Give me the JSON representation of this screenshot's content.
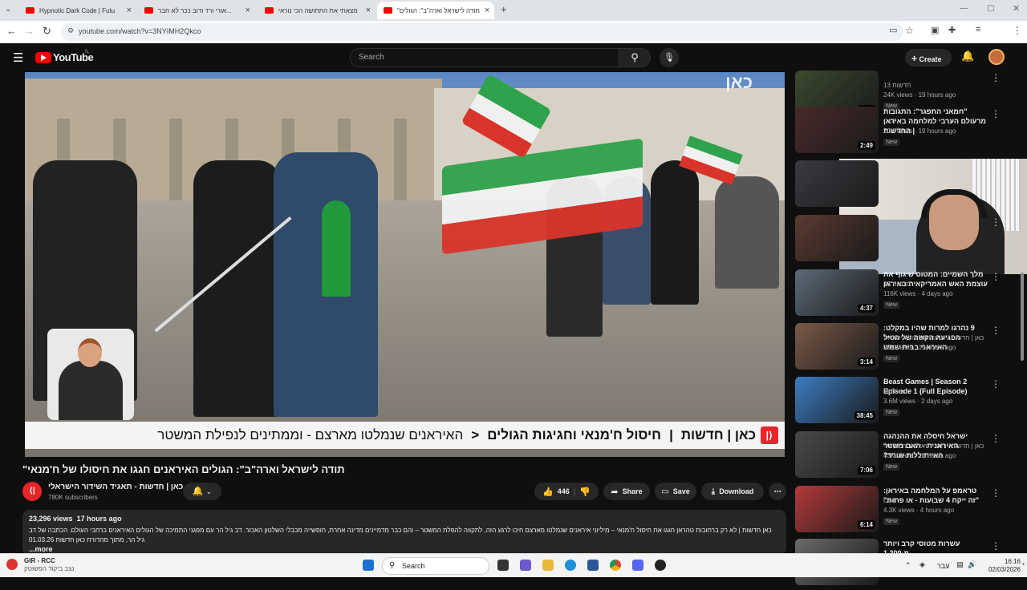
{
  "browser": {
    "tabs": [
      {
        "label": "Hypnotic Dark Code | Futu",
        "active": false
      },
      {
        "label": "אורי ורד ודוב ככר לא חבר...",
        "active": false
      },
      {
        "label": "מצאתי את התחושה הכי נוראי",
        "active": false
      },
      {
        "label": "\"תודה לישראל וארה\"ב\": הגולים",
        "active": true
      }
    ],
    "new_tab": "+",
    "url": "youtube.com/watch?v=3NYIMH2Qkco"
  },
  "youtube": {
    "logo": "YouTube",
    "region": "IL",
    "search_placeholder": "Search",
    "create_label": "Create",
    "icons": [
      "menu-icon",
      "search-icon",
      "mic-icon",
      "bell-icon"
    ]
  },
  "video": {
    "watermark": "כאן",
    "lower_third": {
      "channel": "כאן | חדשות",
      "headline": "חיסול ח'מנאי וחגיגות הגולים",
      "sub": "האיראנים שנמלטו מארצם - וממתינים לנפילת המשטר"
    }
  },
  "watch": {
    "title": "תודה לישראל וארה\"ב\": הגולים האיראנים חגגו את חיסולו של ח'מנאי\"",
    "channel_name": "כאן | חדשות - תאגיד השידור הישראלי",
    "subscribers": "780K subscribers",
    "likes": "446",
    "share_label": "Share",
    "save_label": "Save",
    "download_label": "Download",
    "views": "23,296 views",
    "age": "17 hours ago",
    "description": "כאן חדשות | לא רק ברחובות טהראן חגגו את חיסול ח'מנאי – מיליוני איראנים שנמלטו מארצם חיכו לרגע הזה, לתקווה להפלת המשטר – והם כבר מדמיינים מדינה אחרת, חופשייה מכבלי השלטון האכזר. דב גיל הר עם מפגני התמיכה של הגולים האיראנים ברחבי העולם. הכתבה של דב גיל הר, מתוך מהדורת כאן חדשות 01.03.26",
    "more_label": "...more"
  },
  "recommendations": [
    {
      "title": "",
      "channel": "חדשות 13",
      "views": "24K views",
      "age": "19 hours ago",
      "badge": "New",
      "duration": "3:37",
      "thumb_color": "#3b4a2f"
    },
    {
      "title": "\"חמאני התפגר\": התגובות מרעולם הערבי למלחמה באיראן | החדשות",
      "channel": "C14",
      "views": "20K views",
      "age": "19 hours ago",
      "badge": "New",
      "duration": "2:49",
      "thumb_color": "#4a2a2a"
    },
    {
      "title": "",
      "channel": "",
      "views": "",
      "age": "",
      "badge": "",
      "duration": "",
      "thumb_color": "#3a3a40"
    },
    {
      "title": "",
      "channel": "",
      "views": "",
      "age": "",
      "badge": "",
      "duration": "",
      "thumb_color": "#5a3a30"
    },
    {
      "title": "מלך השמיים: המטוס שיגוף את עוצמת האש האמריקאית באיראן",
      "channel": "חדשות 13",
      "views": "116K views",
      "age": "4 days ago",
      "badge": "New",
      "duration": "4:37",
      "thumb_color": "#5c6a78"
    },
    {
      "title": "9 נהרגו למרות שהיו במקלט: הפגיעה הקשה של הטיל האיראני בבית שמש",
      "channel": "כאן | חדשות - תאגיד השידור הישראלי",
      "views": "25K views",
      "age": "19 hours ago",
      "badge": "New",
      "duration": "3:14",
      "thumb_color": "#7a5a48"
    },
    {
      "title": "Beast Games | Season 2 Episode 1 (Full Episode)",
      "channel": "MrBeast",
      "views": "3.6M views",
      "age": "2 days ago",
      "badge": "New",
      "duration": "38:45",
      "thumb_color": "#3c7dc4"
    },
    {
      "title": "ישראל חיסלה את ההנהגה האיראנית - האם משטר האייתוללות שורד?",
      "channel": "כאן | חדשות - תאגיד השידור הישראלי",
      "views": "43K views",
      "age": "16 hours ago",
      "badge": "New",
      "duration": "7:06",
      "thumb_color": "#4a4a4a"
    },
    {
      "title": "טראמפ על המלחמה באיראן: \"זה ייקח 4 שבועות - או פחות\"",
      "channel": "C14",
      "views": "4.3K views",
      "age": "4 hours ago",
      "badge": "New",
      "duration": "6:14",
      "thumb_color": "#b43a3a"
    },
    {
      "title": "עשרות מטוסי קרב ויותר מ-1,200",
      "channel": "",
      "views": "",
      "age": "",
      "badge": "",
      "duration": "",
      "thumb_color": "#6a6a6a"
    }
  ],
  "taskbar": {
    "weather_title": "GIR - RCC",
    "weather_sub": "נצב ביקוד הפשוטק",
    "search_label": "Search",
    "lang": "עבר",
    "time": "16:16",
    "date": "02/03/2026"
  }
}
